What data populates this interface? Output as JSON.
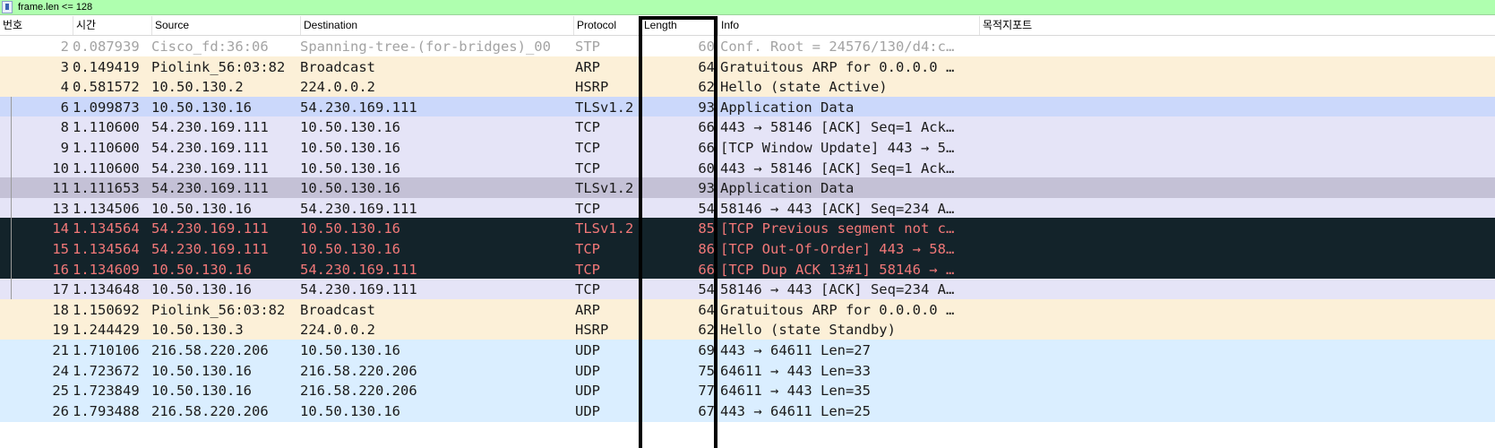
{
  "filter": {
    "text": "frame.len <= 128"
  },
  "columns": {
    "no": "번호",
    "time": "시간",
    "source": "Source",
    "destination": "Destination",
    "protocol": "Protocol",
    "length": "Length",
    "info": "Info",
    "custom": "목적지포트"
  },
  "colors": {
    "stp_bg": "#ffffff",
    "stp_fg": "#a3a3a3",
    "arp_bg": "#fcf0d8",
    "tls_bg": "#e5e4f7",
    "tls_sel_bg": "#cbd8fb",
    "grey_bg": "#c4c1d6",
    "err_bg": "#13232a",
    "err_fg": "#f27878",
    "udp_bg": "#daeeff",
    "text": "#1b1b1b"
  },
  "packets": [
    {
      "no": "2",
      "time": "0.087939",
      "source": "Cisco_fd:36:06",
      "destination": "Spanning-tree-(for-bridges)_00",
      "protocol": "STP",
      "length": "60",
      "info": "Conf. Root = 24576/130/d4:c…",
      "style": "stp"
    },
    {
      "no": "3",
      "time": "0.149419",
      "source": "Piolink_56:03:82",
      "destination": "Broadcast",
      "protocol": "ARP",
      "length": "64",
      "info": "Gratuitous ARP for 0.0.0.0 …",
      "style": "arp"
    },
    {
      "no": "4",
      "time": "0.581572",
      "source": "10.50.130.2",
      "destination": "224.0.0.2",
      "protocol": "HSRP",
      "length": "62",
      "info": "Hello (state Active)",
      "style": "arp"
    },
    {
      "no": "6",
      "time": "1.099873",
      "source": "10.50.130.16",
      "destination": "54.230.169.111",
      "protocol": "TLSv1.2",
      "length": "93",
      "info": "Application Data",
      "style": "tls_sel"
    },
    {
      "no": "8",
      "time": "1.110600",
      "source": "54.230.169.111",
      "destination": "10.50.130.16",
      "protocol": "TCP",
      "length": "66",
      "info": "443 → 58146 [ACK] Seq=1 Ack…",
      "style": "tls"
    },
    {
      "no": "9",
      "time": "1.110600",
      "source": "54.230.169.111",
      "destination": "10.50.130.16",
      "protocol": "TCP",
      "length": "66",
      "info": "[TCP Window Update] 443 → 5…",
      "style": "tls"
    },
    {
      "no": "10",
      "time": "1.110600",
      "source": "54.230.169.111",
      "destination": "10.50.130.16",
      "protocol": "TCP",
      "length": "60",
      "info": "443 → 58146 [ACK] Seq=1 Ack…",
      "style": "tls"
    },
    {
      "no": "11",
      "time": "1.111653",
      "source": "54.230.169.111",
      "destination": "10.50.130.16",
      "protocol": "TLSv1.2",
      "length": "93",
      "info": "Application Data",
      "style": "grey"
    },
    {
      "no": "13",
      "time": "1.134506",
      "source": "10.50.130.16",
      "destination": "54.230.169.111",
      "protocol": "TCP",
      "length": "54",
      "info": "58146 → 443 [ACK] Seq=234 A…",
      "style": "tls"
    },
    {
      "no": "14",
      "time": "1.134564",
      "source": "54.230.169.111",
      "destination": "10.50.130.16",
      "protocol": "TLSv1.2",
      "length": "85",
      "info": "[TCP Previous segment not c…",
      "style": "err"
    },
    {
      "no": "15",
      "time": "1.134564",
      "source": "54.230.169.111",
      "destination": "10.50.130.16",
      "protocol": "TCP",
      "length": "86",
      "info": "[TCP Out-Of-Order] 443 → 58…",
      "style": "err"
    },
    {
      "no": "16",
      "time": "1.134609",
      "source": "10.50.130.16",
      "destination": "54.230.169.111",
      "protocol": "TCP",
      "length": "66",
      "info": "[TCP Dup ACK 13#1] 58146 → …",
      "style": "err"
    },
    {
      "no": "17",
      "time": "1.134648",
      "source": "10.50.130.16",
      "destination": "54.230.169.111",
      "protocol": "TCP",
      "length": "54",
      "info": "58146 → 443 [ACK] Seq=234 A…",
      "style": "tls"
    },
    {
      "no": "18",
      "time": "1.150692",
      "source": "Piolink_56:03:82",
      "destination": "Broadcast",
      "protocol": "ARP",
      "length": "64",
      "info": "Gratuitous ARP for 0.0.0.0 …",
      "style": "arp"
    },
    {
      "no": "19",
      "time": "1.244429",
      "source": "10.50.130.3",
      "destination": "224.0.0.2",
      "protocol": "HSRP",
      "length": "62",
      "info": "Hello (state Standby)",
      "style": "arp"
    },
    {
      "no": "21",
      "time": "1.710106",
      "source": "216.58.220.206",
      "destination": "10.50.130.16",
      "protocol": "UDP",
      "length": "69",
      "info": "443 → 64611 Len=27",
      "style": "udp"
    },
    {
      "no": "24",
      "time": "1.723672",
      "source": "10.50.130.16",
      "destination": "216.58.220.206",
      "protocol": "UDP",
      "length": "75",
      "info": "64611 → 443 Len=33",
      "style": "udp"
    },
    {
      "no": "25",
      "time": "1.723849",
      "source": "10.50.130.16",
      "destination": "216.58.220.206",
      "protocol": "UDP",
      "length": "77",
      "info": "64611 → 443 Len=35",
      "style": "udp"
    },
    {
      "no": "26",
      "time": "1.793488",
      "source": "216.58.220.206",
      "destination": "10.50.130.16",
      "protocol": "UDP",
      "length": "67",
      "info": "443 → 64611 Len=25",
      "style": "udp"
    }
  ]
}
